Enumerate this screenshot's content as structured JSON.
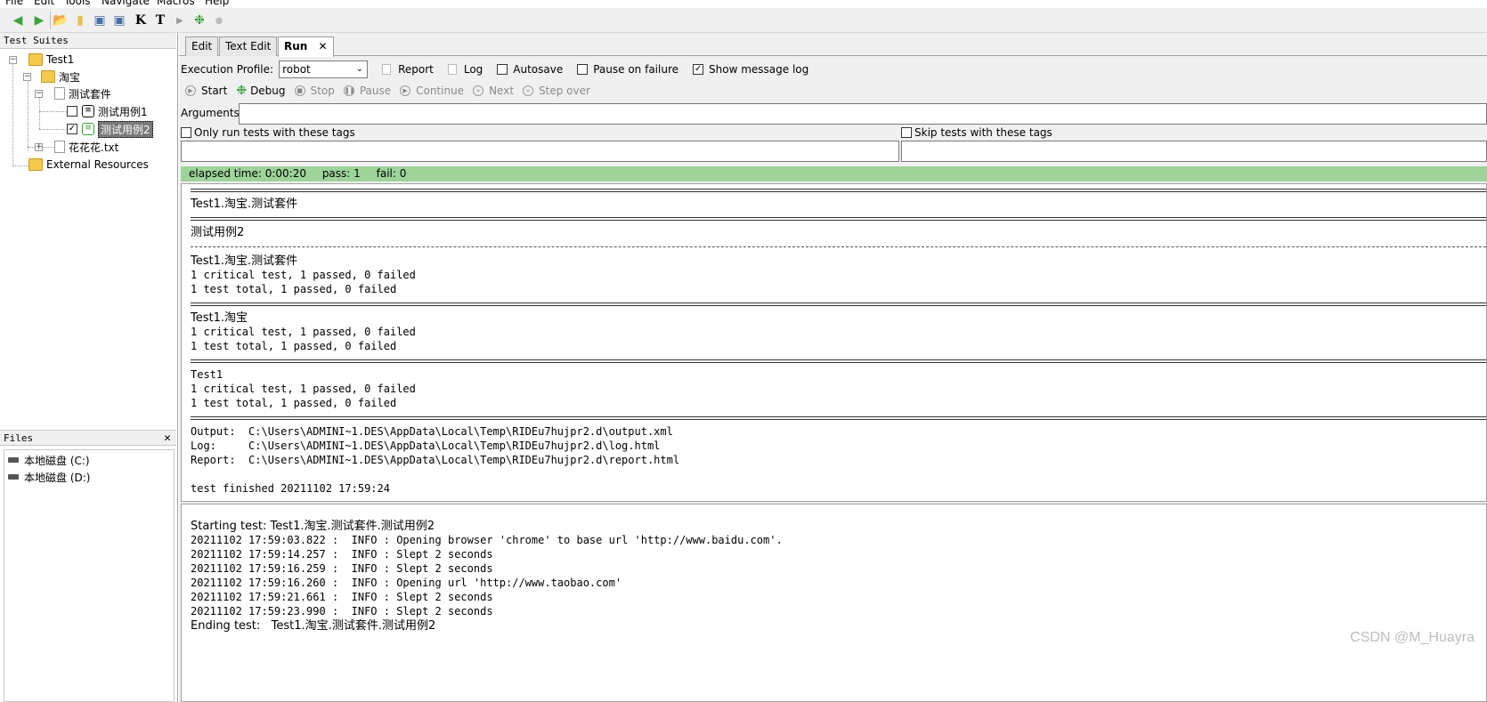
{
  "menu": [
    "File",
    "Edit",
    "Tools",
    "Navigate",
    "Macros",
    "Help"
  ],
  "toolbar_icons": [
    "back-icon",
    "forward-icon",
    "open-icon",
    "new-file-icon",
    "save-icon",
    "save-all-icon",
    "keyword-icon",
    "testcase-icon",
    "run-icon",
    "debug-icon",
    "stop-icon"
  ],
  "toolbar_glyphs": {
    "keyword": "K",
    "testcase": "T"
  },
  "suites": {
    "header": "Test Suites",
    "tree": {
      "root": "Test1",
      "child": "淘宝",
      "suite": "测试套件",
      "case1": "测试用例1",
      "case2": "测试用例2",
      "resource_file": "花花花.txt",
      "external": "External Resources"
    }
  },
  "files": {
    "header": "Files",
    "close": "✕",
    "drives": [
      "本地磁盘 (C:)",
      "本地磁盘 (D:)"
    ]
  },
  "tabs": [
    {
      "label": "Edit"
    },
    {
      "label": "Text Edit"
    },
    {
      "label": "Run",
      "active": true,
      "close": "✕"
    }
  ],
  "run": {
    "profile_label": "Execution Profile:",
    "profile_value": "robot",
    "report": "Report",
    "log": "Log",
    "autosave": "Autosave",
    "pause_on_failure": "Pause on failure",
    "show_message_log": "Show message log",
    "show_message_log_checked": true,
    "buttons": {
      "start": "Start",
      "debug": "Debug",
      "stop": "Stop",
      "pause": "Pause",
      "continue": "Continue",
      "next": "Next",
      "step_over": "Step over"
    },
    "arguments_label": "Arguments:",
    "only_run_tags": "Only run tests with these tags",
    "skip_tags": "Skip tests with these tags"
  },
  "status": {
    "elapsed": "elapsed time: 0:00:20",
    "pass": "pass: 1",
    "fail": "fail: 0",
    "color": "#9dd49a"
  },
  "output": {
    "suite1": "Test1.淘宝.测试套件",
    "case": "测试用例2",
    "suite1_again": "Test1.淘宝.测试套件",
    "crit1": "1 critical test, 1 passed, 0 failed",
    "total1": "1 test total, 1 passed, 0 failed",
    "suite2": "Test1.淘宝",
    "crit2": "1 critical test, 1 passed, 0 failed",
    "total2": "1 test total, 1 passed, 0 failed",
    "suite3": "Test1",
    "crit3": "1 critical test, 1 passed, 0 failed",
    "total3": "1 test total, 1 passed, 0 failed",
    "output_path": "Output:  C:\\Users\\ADMINI~1.DES\\AppData\\Local\\Temp\\RIDEu7hujpr2.d\\output.xml",
    "log_path": "Log:     C:\\Users\\ADMINI~1.DES\\AppData\\Local\\Temp\\RIDEu7hujpr2.d\\log.html",
    "report_path": "Report:  C:\\Users\\ADMINI~1.DES\\AppData\\Local\\Temp\\RIDEu7hujpr2.d\\report.html",
    "finished": "test finished 20211102 17:59:24"
  },
  "message_log": [
    "Starting test: Test1.淘宝.测试套件.测试用例2",
    "20211102 17:59:03.822 :  INFO : Opening browser 'chrome' to base url 'http://www.baidu.com'.",
    "20211102 17:59:14.257 :  INFO : Slept 2 seconds",
    "20211102 17:59:16.259 :  INFO : Slept 2 seconds",
    "20211102 17:59:16.260 :  INFO : Opening url 'http://www.taobao.com'",
    "20211102 17:59:21.661 :  INFO : Slept 2 seconds",
    "20211102 17:59:23.990 :  INFO : Slept 2 seconds",
    "Ending test:   Test1.淘宝.测试套件.测试用例2"
  ],
  "watermark": "CSDN @M_Huayra"
}
